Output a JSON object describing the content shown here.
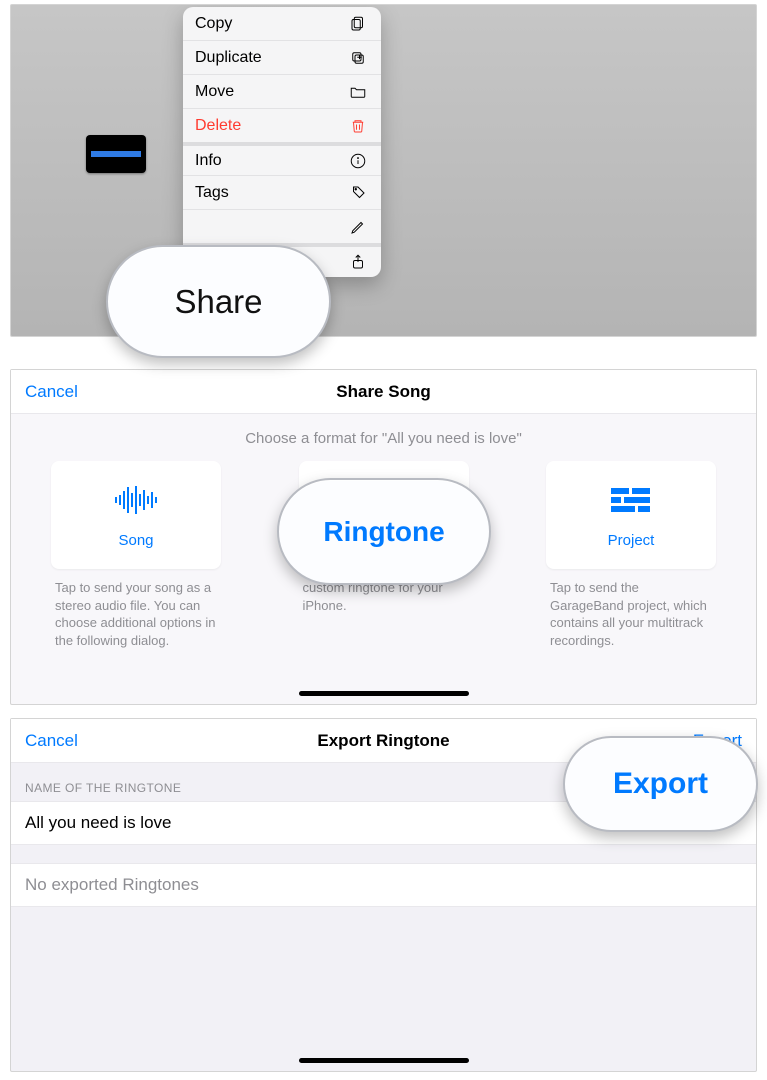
{
  "song_name": "All you need is love",
  "panel1": {
    "menu": {
      "copy": "Copy",
      "duplicate": "Duplicate",
      "move": "Move",
      "delete": "Delete",
      "info": "Info",
      "tags": "Tags",
      "share": "Share"
    }
  },
  "panel2": {
    "cancel": "Cancel",
    "title": "Share Song",
    "subtitle": "Choose a format for \"All you need is love\"",
    "cards": {
      "song": {
        "label": "Song",
        "desc": "Tap to send your song as a stereo audio file. You can choose additional options in the following dialog."
      },
      "ringtone": {
        "label": "Ringtone",
        "desc": "custom ringtone for your iPhone."
      },
      "project": {
        "label": "Project",
        "desc": "Tap to send the GarageBand project, which contains all your multitrack recordings."
      }
    }
  },
  "panel3": {
    "cancel": "Cancel",
    "title": "Export Ringtone",
    "export": "Export",
    "section_header": "NAME OF THE RINGTONE",
    "name_value": "All you need is love",
    "status": "No exported Ringtones"
  },
  "callouts": {
    "share": "Share",
    "ringtone": "Ringtone",
    "export": "Export"
  }
}
